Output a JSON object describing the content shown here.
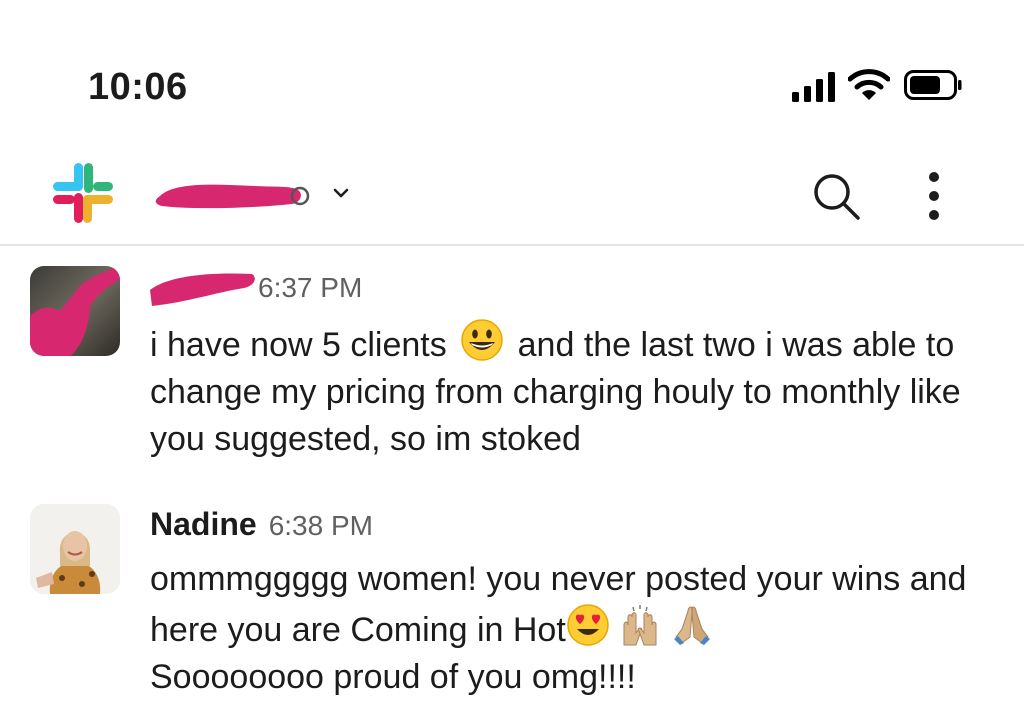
{
  "status_bar": {
    "time": "10:06"
  },
  "header": {
    "workspace_name": "",
    "icons": [
      "slack-logo",
      "chevron-down-icon",
      "search-icon",
      "more-vertical-icon"
    ]
  },
  "messages": [
    {
      "author": "",
      "time": "6:37 PM",
      "text_before_emoji": "i have now 5 clients",
      "emoji": "grinning-face",
      "text_after_emoji": "and the last two i was able to change my pricing from charging houly to monthly like you suggested, so im stoked"
    },
    {
      "author": "Nadine",
      "time": "6:38 PM",
      "text_before_emoji": "ommmggggg women! you never posted your wins and here you are Coming in Hot",
      "emojis": [
        "heart-eyes",
        "raising-hands",
        "folded-hands"
      ],
      "text_after_emoji": "Soooooooo proud of you omg!!!!"
    }
  ],
  "colors": {
    "redaction": "#d6276f",
    "text": "#1d1c1d",
    "muted": "#616061"
  }
}
